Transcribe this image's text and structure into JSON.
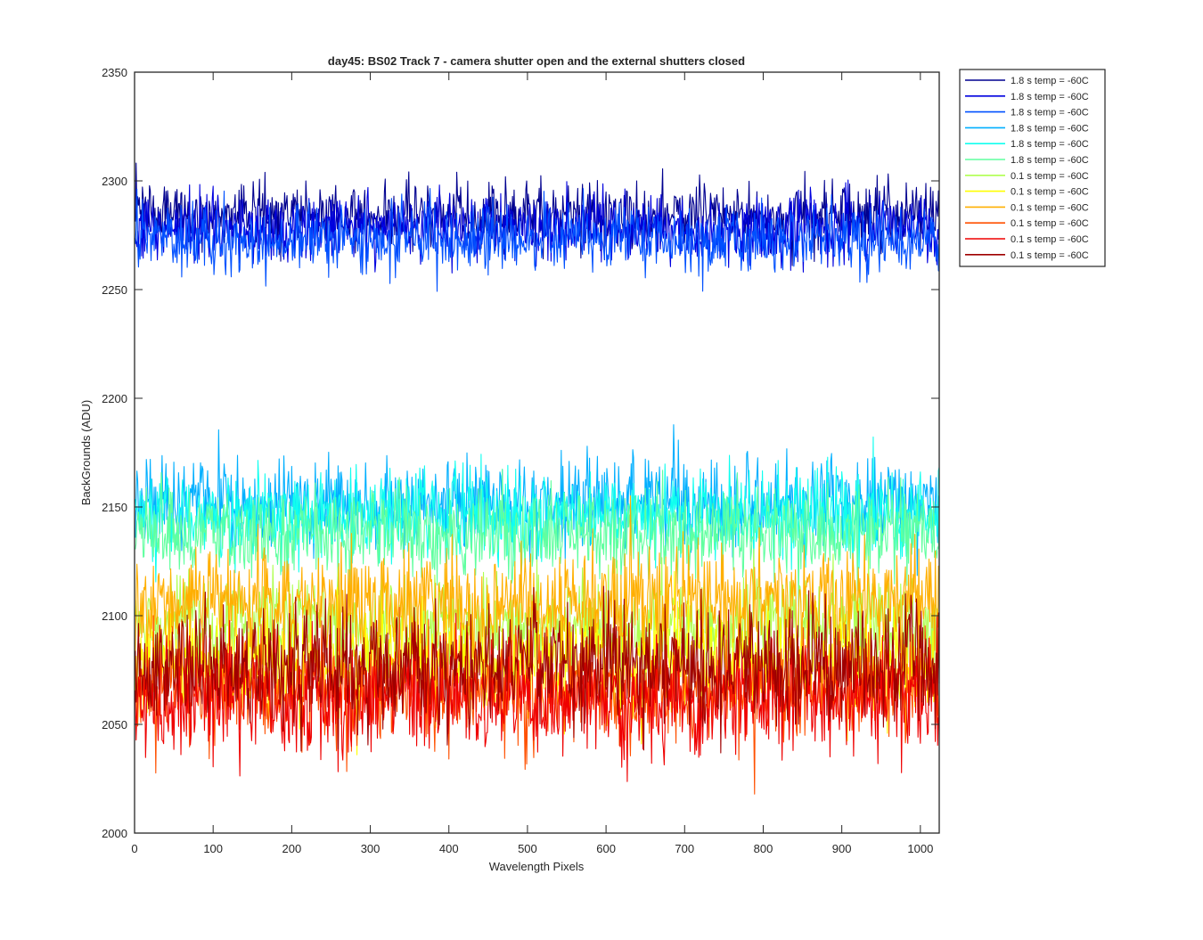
{
  "chart_data": {
    "type": "line",
    "title": "day45: BS02  Track 7 - camera shutter open and the external shutters closed",
    "xlabel": "Wavelength Pixels",
    "ylabel": "BackGrounds (ADU)",
    "xlim": [
      0,
      1024
    ],
    "ylim": [
      2000,
      2350
    ],
    "x_ticks": [
      0,
      100,
      200,
      300,
      400,
      500,
      600,
      700,
      800,
      900,
      1000
    ],
    "y_ticks": [
      2000,
      2050,
      2100,
      2150,
      2200,
      2250,
      2300,
      2350
    ],
    "x_range": [
      1,
      1024
    ],
    "grid": false,
    "legend_position": "outside-top-right",
    "series": [
      {
        "name": "1.8 s temp = -60C",
        "color": "#00008f",
        "mean": 2284,
        "noise": 7.5
      },
      {
        "name": "1.8 s temp = -60C",
        "color": "#0000df",
        "mean": 2278,
        "noise": 7.5
      },
      {
        "name": "1.8 s temp = -60C",
        "color": "#0050ff",
        "mean": 2273,
        "noise": 7.5
      },
      {
        "name": "1.8 s temp = -60C",
        "color": "#00afff",
        "mean": 2152,
        "noise": 10
      },
      {
        "name": "1.8 s temp = -60C",
        "color": "#10ffef",
        "mean": 2146,
        "noise": 10
      },
      {
        "name": "1.8 s temp = -60C",
        "color": "#60ff9f",
        "mean": 2138,
        "noise": 10
      },
      {
        "name": "0.1 s temp = -60C",
        "color": "#afff50",
        "mean": 2096,
        "noise": 11
      },
      {
        "name": "0.1 s temp = -60C",
        "color": "#ffff00",
        "mean": 2078,
        "noise": 13
      },
      {
        "name": "0.1 s temp = -60C",
        "color": "#ffaf00",
        "mean": 2106,
        "noise": 13
      },
      {
        "name": "0.1 s temp = -60C",
        "color": "#ff5000",
        "mean": 2066,
        "noise": 13
      },
      {
        "name": "0.1 s temp = -60C",
        "color": "#ef0000",
        "mean": 2062,
        "noise": 13
      },
      {
        "name": "0.1 s temp = -60C",
        "color": "#9f0000",
        "mean": 2078,
        "noise": 14
      }
    ]
  }
}
